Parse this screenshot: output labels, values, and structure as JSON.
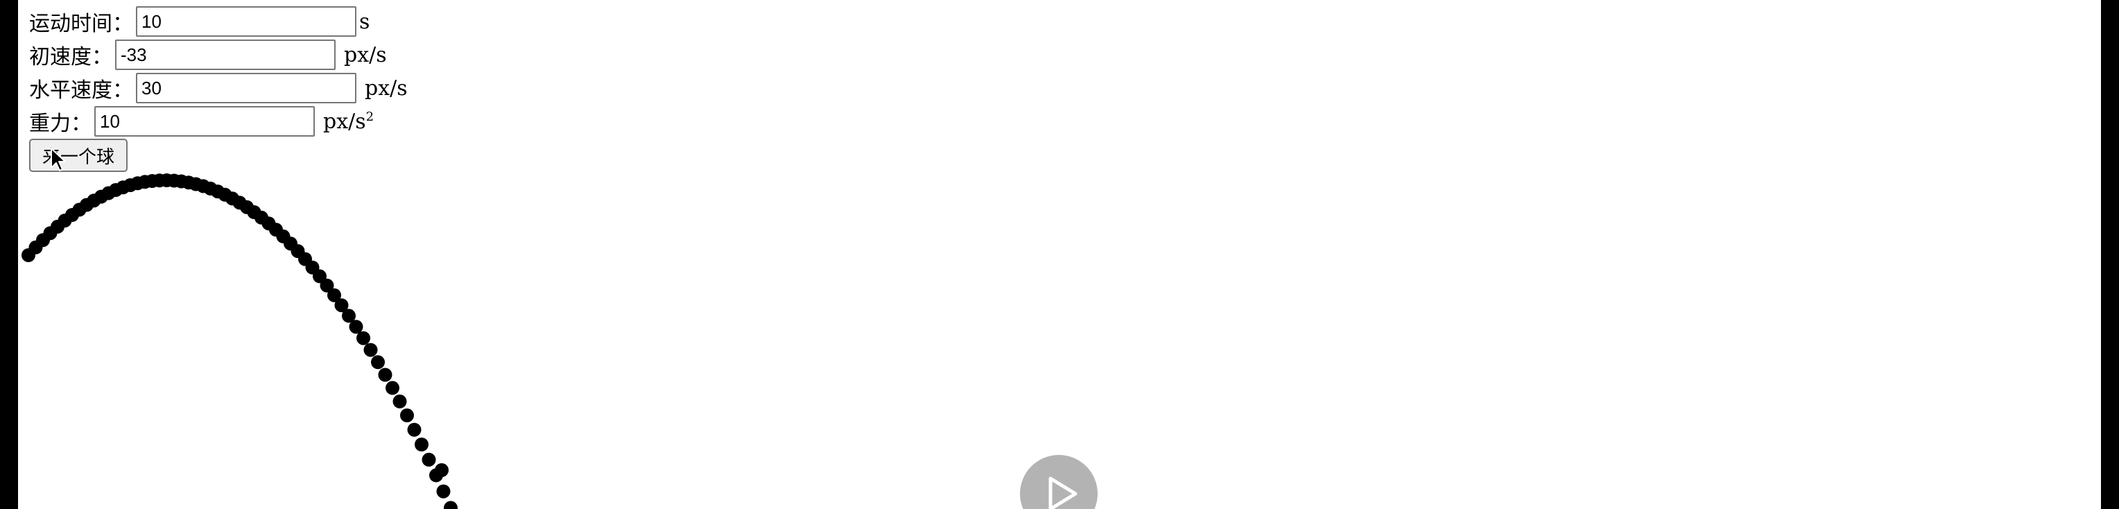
{
  "form": {
    "duration": {
      "label": "运动时间：",
      "value": "10",
      "unit": "s"
    },
    "initial_speed": {
      "label": "初速度：",
      "value": "-33",
      "unit": "px/s"
    },
    "horizontal_speed": {
      "label": "水平速度：",
      "value": "30",
      "unit": "px/s"
    },
    "gravity": {
      "label": "重力：",
      "value": "10",
      "unit": "px/s",
      "unit_exponent": "2"
    },
    "launch_button_label": "来一个球"
  },
  "simulation": {
    "ball_color": "#000000",
    "ball_count": 59
  },
  "video_overlay": {
    "play_icon": "play-icon",
    "color": "#b3b3b3"
  }
}
